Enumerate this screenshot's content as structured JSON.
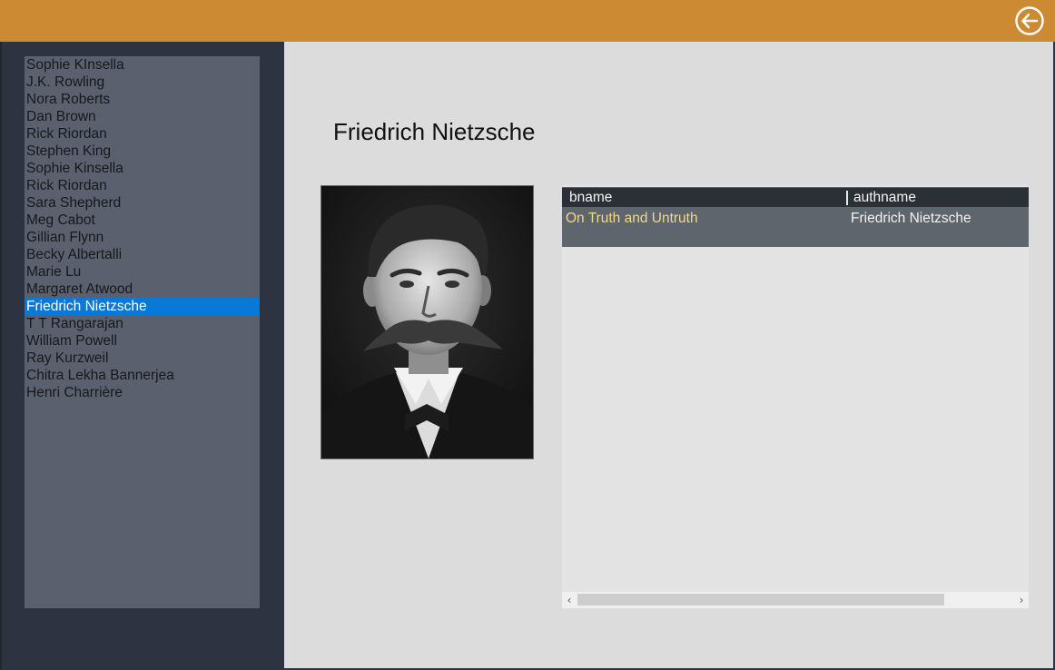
{
  "header": {
    "back_icon": "circle-arrow-left-icon",
    "accent_color": "#cc8b33"
  },
  "sidebar": {
    "authors": [
      "Sophie KInsella",
      "J.K. Rowling",
      "Nora Roberts",
      "Dan Brown",
      "Rick Riordan",
      "Stephen King",
      "Sophie Kinsella",
      "Rick Riordan",
      "Sara Shepherd",
      "Meg Cabot",
      "Gillian Flynn",
      "Becky Albertalli",
      "Marie Lu",
      "Margaret Atwood",
      "Friedrich Nietzsche",
      "T T Rangarajan",
      "William Powell",
      "Ray Kurzweil",
      "Chitra Lekha Bannerjea",
      "Henri Charrière"
    ],
    "selected_index": 14,
    "selection_color": "#0a78d7"
  },
  "main": {
    "author_name": "Friedrich Nietzsche",
    "table": {
      "columns": [
        "bname",
        "authname"
      ],
      "rows": [
        [
          "On Truth and Untruth",
          "Friedrich Nietzsche"
        ]
      ]
    }
  }
}
